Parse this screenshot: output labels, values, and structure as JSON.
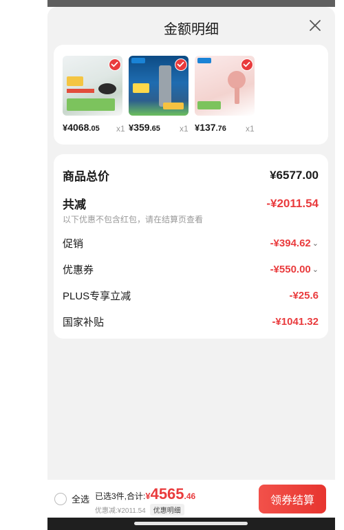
{
  "sheet": {
    "title": "金额明细"
  },
  "products": [
    {
      "price_yen": "¥",
      "price_int": "4068",
      "price_dec": ".05",
      "qty": "x1",
      "thumb_colors": [
        "#e9eef0",
        "#b9c8c0",
        "#2b2b2b"
      ]
    },
    {
      "price_yen": "¥",
      "price_int": "359",
      "price_dec": ".65",
      "qty": "x1",
      "thumb_colors": [
        "#0e4f86",
        "#2b6fb0",
        "#7fbf6b"
      ]
    },
    {
      "price_yen": "¥",
      "price_int": "137",
      "price_dec": ".76",
      "qty": "x1",
      "thumb_colors": [
        "#f6dcd9",
        "#e89c95",
        "#ffffff"
      ]
    }
  ],
  "summary": {
    "total_label": "商品总价",
    "total_value": "¥6577.00",
    "reduce_label": "共减",
    "reduce_value": "-¥2011.54",
    "note": "以下优惠不包含红包，请在结算页查看",
    "promo_label": "促销",
    "promo_value": "-¥394.62",
    "coupon_label": "优惠券",
    "coupon_value": "-¥550.00",
    "plus_label": "PLUS专享立减",
    "plus_value": "-¥25.6",
    "subsidy_label": "国家补贴",
    "subsidy_value": "-¥1041.32"
  },
  "bottom": {
    "select_all": "全选",
    "selected_text": "已选3件,合计:",
    "total_yen": "¥",
    "total_int": "4565",
    "total_dec": ".46",
    "discount_text": "优惠减:¥2011.54",
    "detail_tag": "优惠明细",
    "checkout": "领券结算"
  },
  "colors": {
    "accent": "#e93b3d",
    "sheet_bg": "#f2f2f2",
    "card_bg": "#ffffff"
  },
  "icons": {
    "close": "close-icon",
    "check": "check-icon",
    "chevron": "chevron-down-icon"
  }
}
